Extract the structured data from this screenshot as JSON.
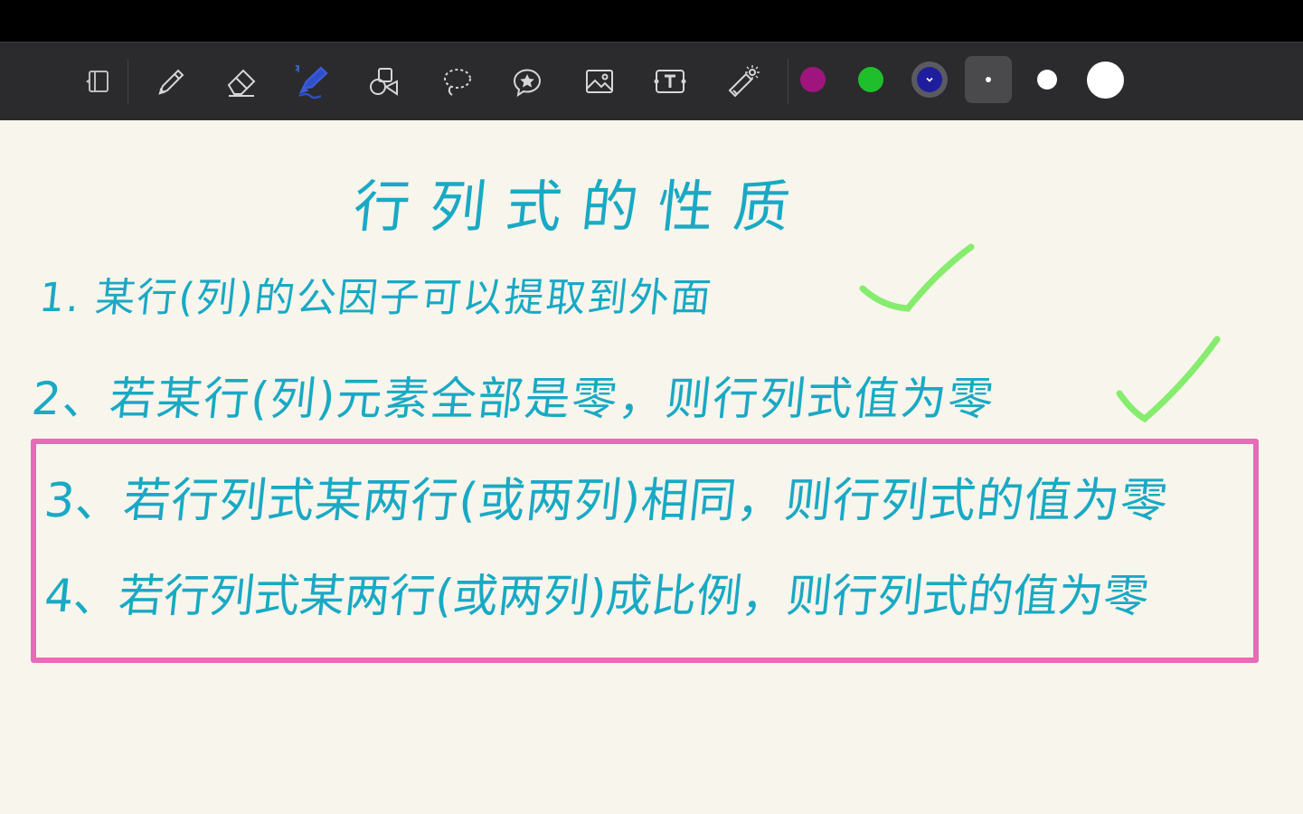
{
  "toolbar": {
    "tools": [
      {
        "name": "read-only-mode",
        "icon": "reader-icon"
      },
      {
        "name": "pen",
        "icon": "pen-icon"
      },
      {
        "name": "eraser",
        "icon": "eraser-icon"
      },
      {
        "name": "highlighter",
        "icon": "highlighter-icon",
        "active": true
      },
      {
        "name": "shapes",
        "icon": "shapes-icon"
      },
      {
        "name": "lasso",
        "icon": "lasso-icon"
      },
      {
        "name": "elements",
        "icon": "star-sticker-icon"
      },
      {
        "name": "image",
        "icon": "image-icon"
      },
      {
        "name": "text",
        "icon": "text-icon"
      },
      {
        "name": "laser-pointer",
        "icon": "laser-pointer-icon"
      }
    ],
    "colors": [
      "#a0157d",
      "#1fbf2c",
      "#1e1e9c"
    ],
    "selected_color": "#1e1e9c",
    "stroke_sizes": [
      "small",
      "medium",
      "large"
    ],
    "selected_size": "small"
  },
  "note": {
    "title": "行列式的性质",
    "lines": [
      "1. 某行(列)的公因子可以提取到外面",
      "2、若某行(列)元素全部是零，则行列式值为零",
      "3、若行列式某两行(或两列)相同，则行列式的值为零",
      "4、若行列式某两行(或两列)成比例，则行列式的值为零"
    ],
    "colors": {
      "ink": "#19a9c4",
      "check": "#86ec6e",
      "box": "#e86bb7"
    }
  }
}
